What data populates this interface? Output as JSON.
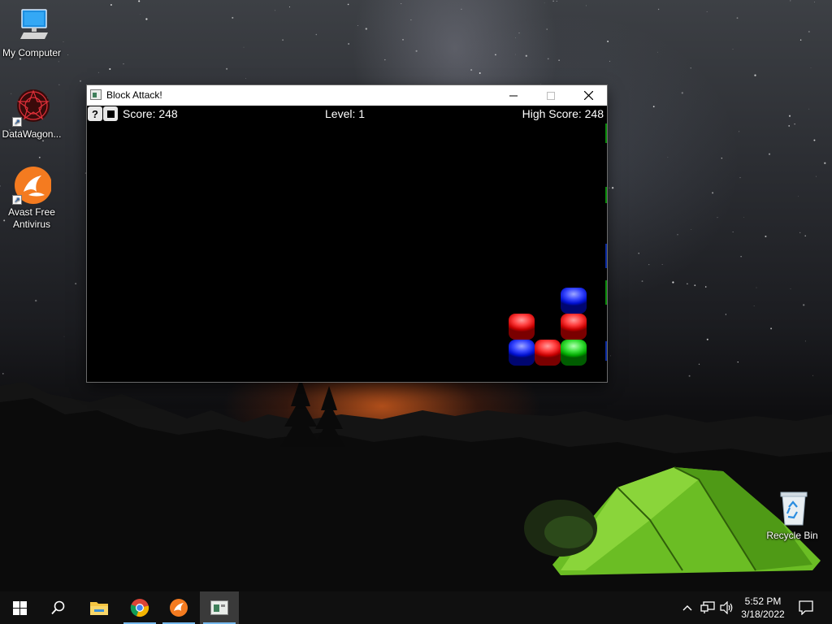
{
  "desktop": {
    "icons": [
      {
        "label": "My Computer",
        "icon": "computer-icon"
      },
      {
        "label": "DataWagon...",
        "icon": "datawagon-icon"
      },
      {
        "label": "Avast Free Antivirus",
        "icon": "avast-icon"
      },
      {
        "label": "Recycle Bin",
        "icon": "recycle-bin-icon"
      }
    ]
  },
  "window": {
    "title": "Block Attack!",
    "controls": {
      "minimize": "minimize-icon",
      "maximize": "maximize-icon",
      "close": "close-icon"
    },
    "game": {
      "help_button": "?",
      "stop_button_icon": "stop-icon",
      "score": "Score: 248",
      "level": "Level: 1",
      "high_score": "High Score: 248",
      "blocks": [
        {
          "color": "blue",
          "column": 3,
          "row": 3
        },
        {
          "color": "red",
          "column": 1,
          "row": 2
        },
        {
          "color": "red",
          "column": 3,
          "row": 2
        },
        {
          "color": "blue",
          "column": 1,
          "row": 1
        },
        {
          "color": "red",
          "column": 2,
          "row": 1
        },
        {
          "color": "green",
          "column": 3,
          "row": 1
        }
      ],
      "block_colors": {
        "red": "#e01010",
        "blue": "#1020f0",
        "green": "#10c010"
      }
    }
  },
  "taskbar": {
    "items": [
      {
        "name": "start-button",
        "icon": "windows-logo-icon"
      },
      {
        "name": "search-button",
        "icon": "search-icon"
      },
      {
        "name": "file-explorer",
        "icon": "folder-icon"
      },
      {
        "name": "chrome",
        "icon": "chrome-icon"
      },
      {
        "name": "avast",
        "icon": "avast-icon"
      },
      {
        "name": "block-attack",
        "icon": "block-attack-icon",
        "active": true
      }
    ],
    "tray": {
      "chevron": "chevron-up-icon",
      "network": "network-icon",
      "volume": "volume-icon",
      "time": "5:52 PM",
      "date": "3/18/2022",
      "notifications": "notification-icon"
    }
  }
}
